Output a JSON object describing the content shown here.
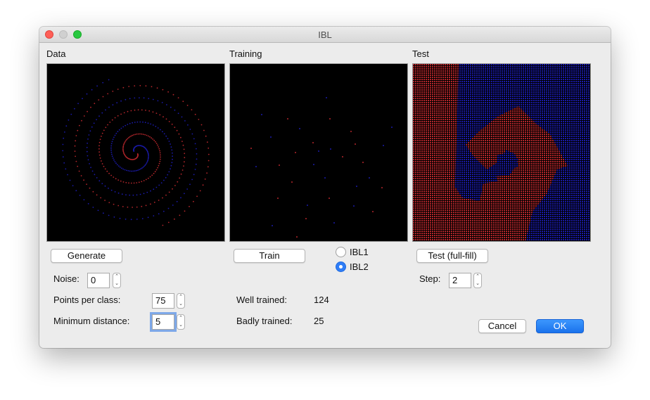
{
  "window": {
    "title": "IBL"
  },
  "panels": {
    "data_label": "Data",
    "training_label": "Training",
    "test_label": "Test"
  },
  "buttons": {
    "generate": "Generate",
    "train": "Train",
    "test": "Test (full-fill)",
    "cancel": "Cancel",
    "ok": "OK"
  },
  "algorithm": {
    "options": [
      {
        "label": "IBL1",
        "selected": false
      },
      {
        "label": "IBL2",
        "selected": true
      }
    ]
  },
  "params": {
    "noise_label": "Noise:",
    "noise_value": "0",
    "points_label": "Points per class:",
    "points_value": "75",
    "min_dist_label": "Minimum distance:",
    "min_dist_value": "5",
    "step_label": "Step:",
    "step_value": "2"
  },
  "stats": {
    "well_label": "Well trained:",
    "well_value": "124",
    "badly_label": "Badly trained:",
    "badly_value": "25"
  },
  "colors": {
    "class_red": "#b3262b",
    "class_blue": "#1a1aa8",
    "canvas_bg": "#000000",
    "accent": "#2f7df6"
  }
}
